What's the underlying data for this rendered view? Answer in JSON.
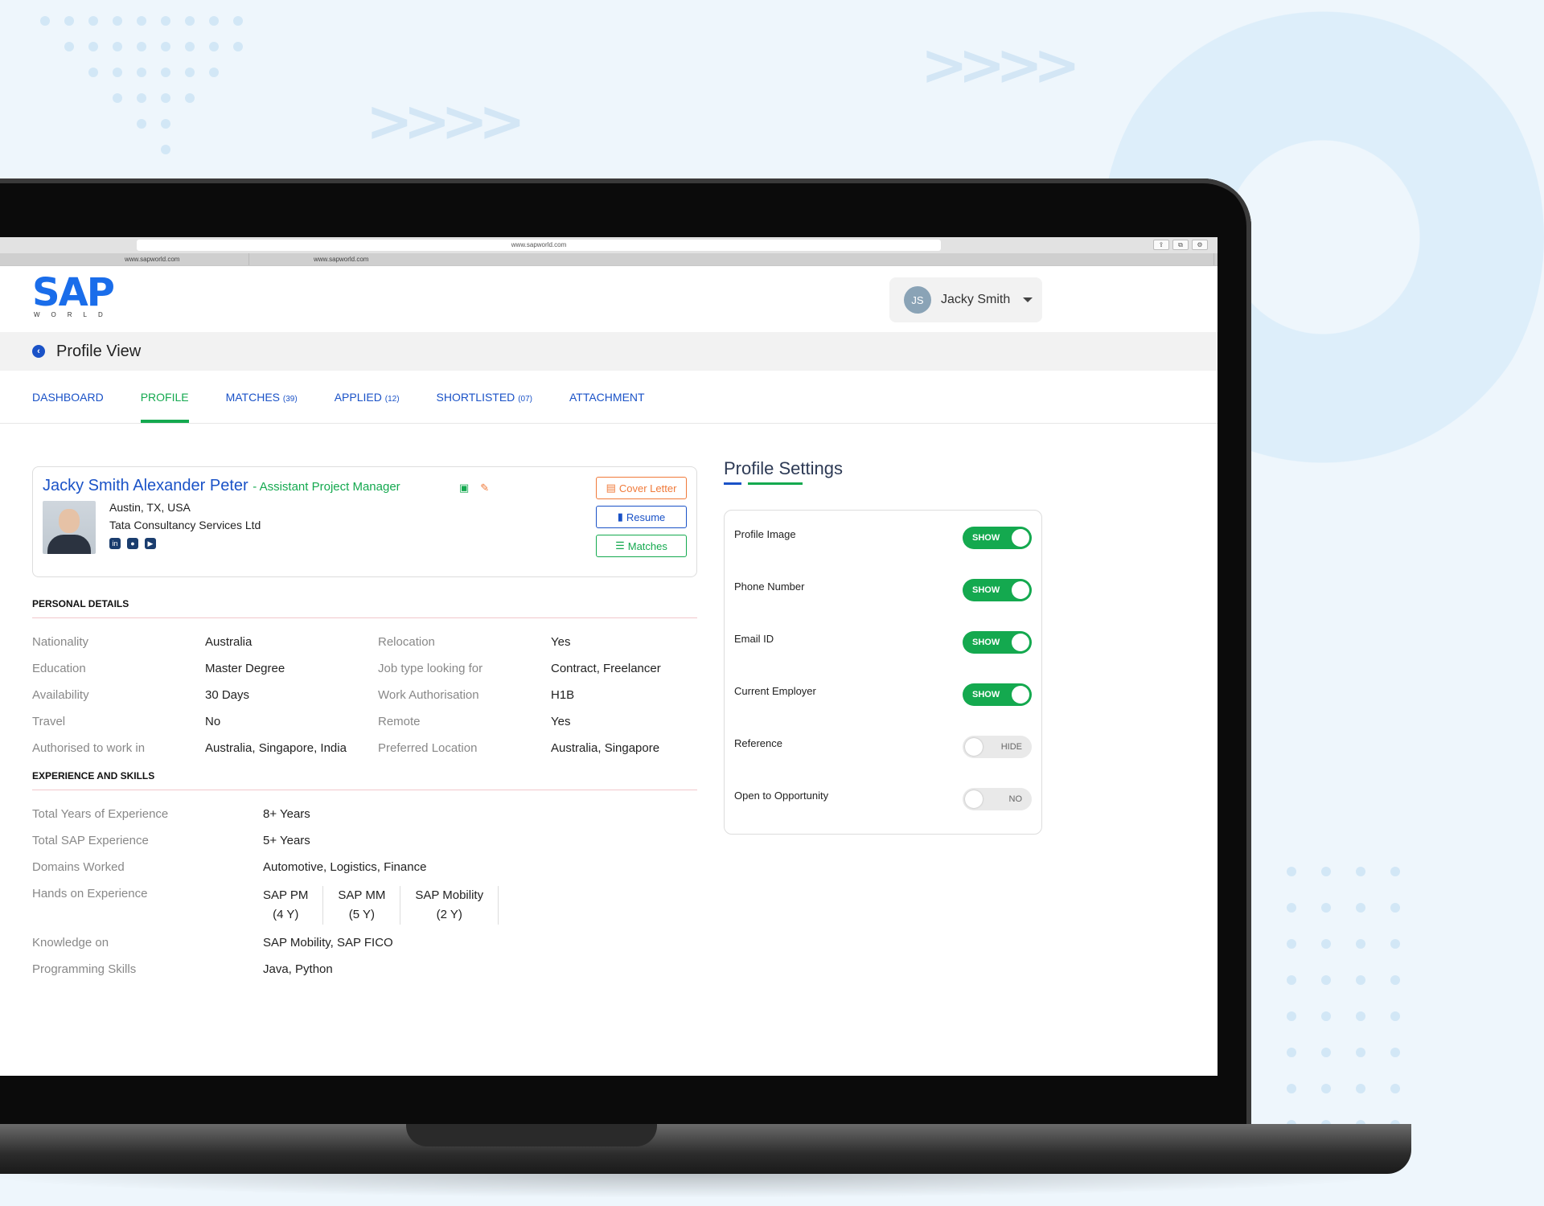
{
  "browser": {
    "url": "www.sapworld.com",
    "tabs": [
      "www.sapworld.com",
      "www.sapworld.com"
    ]
  },
  "header": {
    "logo_text": "SAP",
    "logo_subtext": "WORLD",
    "user_initials": "JS",
    "user_name": "Jacky Smith"
  },
  "page": {
    "title": "Profile View"
  },
  "nav": {
    "tabs": [
      {
        "label": "DASHBOARD",
        "count": ""
      },
      {
        "label": "PROFILE",
        "count": ""
      },
      {
        "label": "MATCHES",
        "count": "(39)"
      },
      {
        "label": "APPLIED",
        "count": "(12)"
      },
      {
        "label": "SHORTLISTED",
        "count": "(07)"
      },
      {
        "label": "ATTACHMENT",
        "count": ""
      }
    ],
    "active": "PROFILE"
  },
  "profile": {
    "name": "Jacky Smith Alexander Peter",
    "role": "- Assistant Project Manager",
    "location": "Austin, TX, USA",
    "employer": "Tata Consultancy Services Ltd",
    "buttons": {
      "cover_letter": "Cover Letter",
      "resume": "Resume",
      "matches": "Matches"
    }
  },
  "personal_details": {
    "heading": "PERSONAL DETAILS",
    "rows": [
      {
        "l1": "Nationality",
        "v1": "Australia",
        "l2": "Relocation",
        "v2": "Yes"
      },
      {
        "l1": "Education",
        "v1": "Master Degree",
        "l2": "Job type looking for",
        "v2": "Contract, Freelancer"
      },
      {
        "l1": "Availability",
        "v1": "30 Days",
        "l2": "Work Authorisation",
        "v2": "H1B"
      },
      {
        "l1": "Travel",
        "v1": "No",
        "l2": "Remote",
        "v2": "Yes"
      },
      {
        "l1": "Authorised to work in",
        "v1": "Australia, Singapore, India",
        "l2": "Preferred Location",
        "v2": "Australia, Singapore"
      }
    ]
  },
  "experience": {
    "heading": "EXPERIENCE AND SKILLS",
    "total_years_label": "Total Years of Experience",
    "total_years": "8+ Years",
    "sap_exp_label": "Total SAP Experience",
    "sap_exp": "5+ Years",
    "domains_label": "Domains Worked",
    "domains": "Automotive, Logistics, Finance",
    "hands_label": "Hands on Experience",
    "hands": [
      {
        "name": "SAP PM",
        "years": "(4 Y)"
      },
      {
        "name": "SAP MM",
        "years": "(5 Y)"
      },
      {
        "name": "SAP Mobility",
        "years": "(2 Y)"
      }
    ],
    "knowledge_label": "Knowledge on",
    "knowledge": "SAP Mobility, SAP FICO",
    "programming_label": "Programming Skills",
    "programming": "Java, Python"
  },
  "settings": {
    "title": "Profile Settings",
    "items": [
      {
        "label": "Profile Image",
        "state": "SHOW",
        "on": true
      },
      {
        "label": "Phone Number",
        "state": "SHOW",
        "on": true
      },
      {
        "label": "Email ID",
        "state": "SHOW",
        "on": true
      },
      {
        "label": "Current Employer",
        "state": "SHOW",
        "on": true
      },
      {
        "label": "Reference",
        "state": "HIDE",
        "on": false
      },
      {
        "label": "Open to Opportunity",
        "state": "NO",
        "on": false
      }
    ]
  },
  "colors": {
    "primary_blue": "#1a52c7",
    "accent_green": "#14a94f",
    "cover_orange": "#f07a3a"
  }
}
